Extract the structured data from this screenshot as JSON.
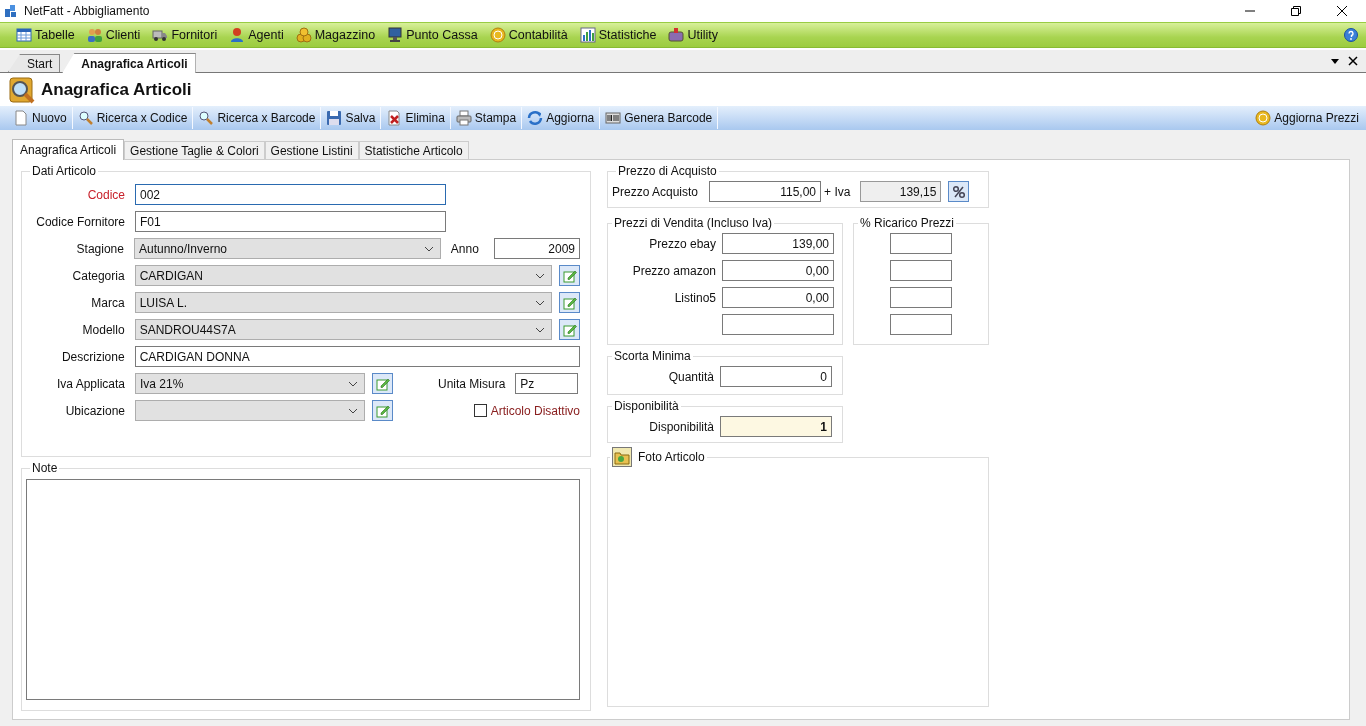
{
  "window": {
    "title": "NetFatt - Abbigliamento"
  },
  "menu": [
    {
      "label": "Tabelle"
    },
    {
      "label": "Clienti"
    },
    {
      "label": "Fornitori"
    },
    {
      "label": "Agenti"
    },
    {
      "label": "Magazzino"
    },
    {
      "label": "Punto Cassa"
    },
    {
      "label": "Contabilità"
    },
    {
      "label": "Statistiche"
    },
    {
      "label": "Utility"
    }
  ],
  "doc_tabs": [
    {
      "label": "Start",
      "selected": false
    },
    {
      "label": "Anagrafica Articoli",
      "selected": true
    }
  ],
  "page_title": "Anagrafica Articoli",
  "toolbar": [
    {
      "label": "Nuovo"
    },
    {
      "label": "Ricerca x Codice"
    },
    {
      "label": "Ricerca x Barcode"
    },
    {
      "label": "Salva"
    },
    {
      "label": "Elimina"
    },
    {
      "label": "Stampa"
    },
    {
      "label": "Aggiorna"
    },
    {
      "label": "Genera Barcode"
    }
  ],
  "toolbar_right": {
    "label": "Aggiorna Prezzi"
  },
  "form_tabs": [
    {
      "label": "Anagrafica Articoli",
      "selected": true
    },
    {
      "label": "Gestione Taglie & Colori",
      "selected": false
    },
    {
      "label": "Gestione Listini",
      "selected": false
    },
    {
      "label": "Statistiche Articolo",
      "selected": false
    }
  ],
  "dati_articolo": {
    "title": "Dati Articolo",
    "rows": [
      {
        "kind": "text",
        "label": "Codice",
        "value": "002",
        "required": true,
        "focused": true
      },
      {
        "kind": "text",
        "label": "Codice Fornitore",
        "value": "F01",
        "required": false,
        "focused": false
      },
      {
        "kind": "select_pair",
        "label": "Stagione",
        "value": "Autunno/Inverno",
        "side_label": "Anno",
        "side_value": "2009",
        "required": false,
        "focused": false
      },
      {
        "kind": "select_edit",
        "label": "Categoria",
        "value": "CARDIGAN",
        "required": false,
        "focused": false
      },
      {
        "kind": "select_edit",
        "label": "Marca",
        "value": "LUISA L.",
        "required": false,
        "focused": false
      },
      {
        "kind": "select_edit",
        "label": "Modello",
        "value": "SANDROU44S7A",
        "required": false,
        "focused": false
      },
      {
        "kind": "text_full",
        "label": "Descrizione",
        "value": "CARDIGAN DONNA",
        "required": false,
        "focused": false
      },
      {
        "kind": "select_short",
        "label": "Iva Applicata",
        "value": "Iva 21%",
        "side_label": "Unita Misura",
        "side_value": "Pz",
        "required": false,
        "focused": false
      },
      {
        "kind": "select_check",
        "label": "Ubicazione",
        "check_label": "Articolo Disattivo",
        "checked": false,
        "required": false,
        "focused": false
      }
    ]
  },
  "note": {
    "title": "Note"
  },
  "prezzo_acquisto": {
    "title": "Prezzo di Acquisto",
    "label": "Prezzo Acquisto",
    "value": "115,00",
    "iva_label": "+ Iva",
    "iva_value": "139,15"
  },
  "prezzi_vendita": {
    "title": "Prezzi di Vendita (Incluso Iva)",
    "rows": [
      {
        "label": "Prezzo ebay",
        "value": "139,00"
      },
      {
        "label": "Prezzo amazon",
        "value": "0,00"
      },
      {
        "label": "Listino5",
        "value": "0,00"
      },
      {}
    ]
  },
  "ricarico": {
    "title": "% Ricarico Prezzi"
  },
  "scorta_minima": {
    "title": "Scorta Minima",
    "label": "Quantità",
    "value": "0"
  },
  "disponibilita": {
    "title": "Disponibilità",
    "label": "Disponibilità",
    "value": "1"
  },
  "foto": {
    "title": "Foto Articolo"
  }
}
